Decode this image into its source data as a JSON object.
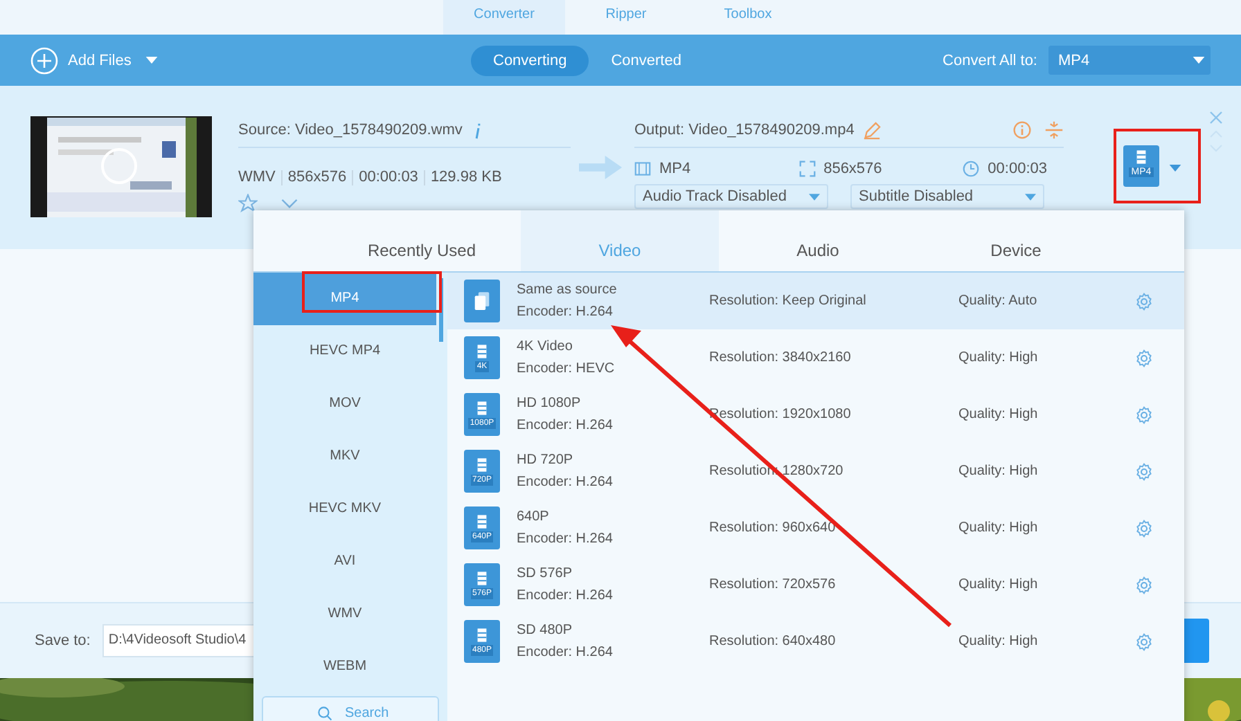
{
  "tabs": [
    {
      "label": "Converter",
      "selected": true
    },
    {
      "label": "Ripper",
      "selected": false
    },
    {
      "label": "Toolbox",
      "selected": false
    }
  ],
  "toolbar": {
    "add_files": "Add Files",
    "views": [
      {
        "label": "Converting",
        "selected": true
      },
      {
        "label": "Converted",
        "selected": false
      }
    ],
    "convert_all_label": "Convert All to:",
    "convert_all_value": "MP4"
  },
  "file": {
    "source": "Source: Video_1578490209.wmv",
    "meta": [
      "WMV",
      "856x576",
      "00:00:03",
      "129.98 KB"
    ],
    "output": "Output: Video_1578490209.mp4",
    "out_format": "MP4",
    "out_resolution": "856x576",
    "out_duration": "00:00:03",
    "audio_track": "Audio Track Disabled",
    "subtitle": "Subtitle Disabled",
    "format_badge": "MP4"
  },
  "save": {
    "label": "Save to:",
    "path": "D:\\4Videosoft Studio\\4"
  },
  "popup": {
    "tabs": [
      {
        "label": "Recently Used",
        "selected": false
      },
      {
        "label": "Video",
        "selected": true
      },
      {
        "label": "Audio",
        "selected": false
      },
      {
        "label": "Device",
        "selected": false
      }
    ],
    "formats": [
      {
        "label": "MP4",
        "selected": true
      },
      {
        "label": "HEVC MP4",
        "selected": false
      },
      {
        "label": "MOV",
        "selected": false
      },
      {
        "label": "MKV",
        "selected": false
      },
      {
        "label": "HEVC MKV",
        "selected": false
      },
      {
        "label": "AVI",
        "selected": false
      },
      {
        "label": "WMV",
        "selected": false
      },
      {
        "label": "WEBM",
        "selected": false
      }
    ],
    "search_placeholder": "Search",
    "presets": [
      {
        "kind": "same",
        "name": "Same as source",
        "encoder": "Encoder: H.264",
        "resolution": "Resolution: Keep Original",
        "quality": "Quality: Auto",
        "selected": true
      },
      {
        "kind": "film",
        "badge": "4K",
        "name": "4K Video",
        "encoder": "Encoder: HEVC",
        "resolution": "Resolution: 3840x2160",
        "quality": "Quality: High",
        "selected": false
      },
      {
        "kind": "film",
        "badge": "1080P",
        "name": "HD 1080P",
        "encoder": "Encoder: H.264",
        "resolution": "Resolution: 1920x1080",
        "quality": "Quality: High",
        "selected": false
      },
      {
        "kind": "film",
        "badge": "720P",
        "name": "HD 720P",
        "encoder": "Encoder: H.264",
        "resolution": "Resolution: 1280x720",
        "quality": "Quality: High",
        "selected": false
      },
      {
        "kind": "film",
        "badge": "640P",
        "name": "640P",
        "encoder": "Encoder: H.264",
        "resolution": "Resolution: 960x640",
        "quality": "Quality: High",
        "selected": false
      },
      {
        "kind": "film",
        "badge": "576P",
        "name": "SD 576P",
        "encoder": "Encoder: H.264",
        "resolution": "Resolution: 720x576",
        "quality": "Quality: High",
        "selected": false
      },
      {
        "kind": "film",
        "badge": "480P",
        "name": "SD 480P",
        "encoder": "Encoder: H.264",
        "resolution": "Resolution: 640x480",
        "quality": "Quality: High",
        "selected": false
      }
    ]
  }
}
